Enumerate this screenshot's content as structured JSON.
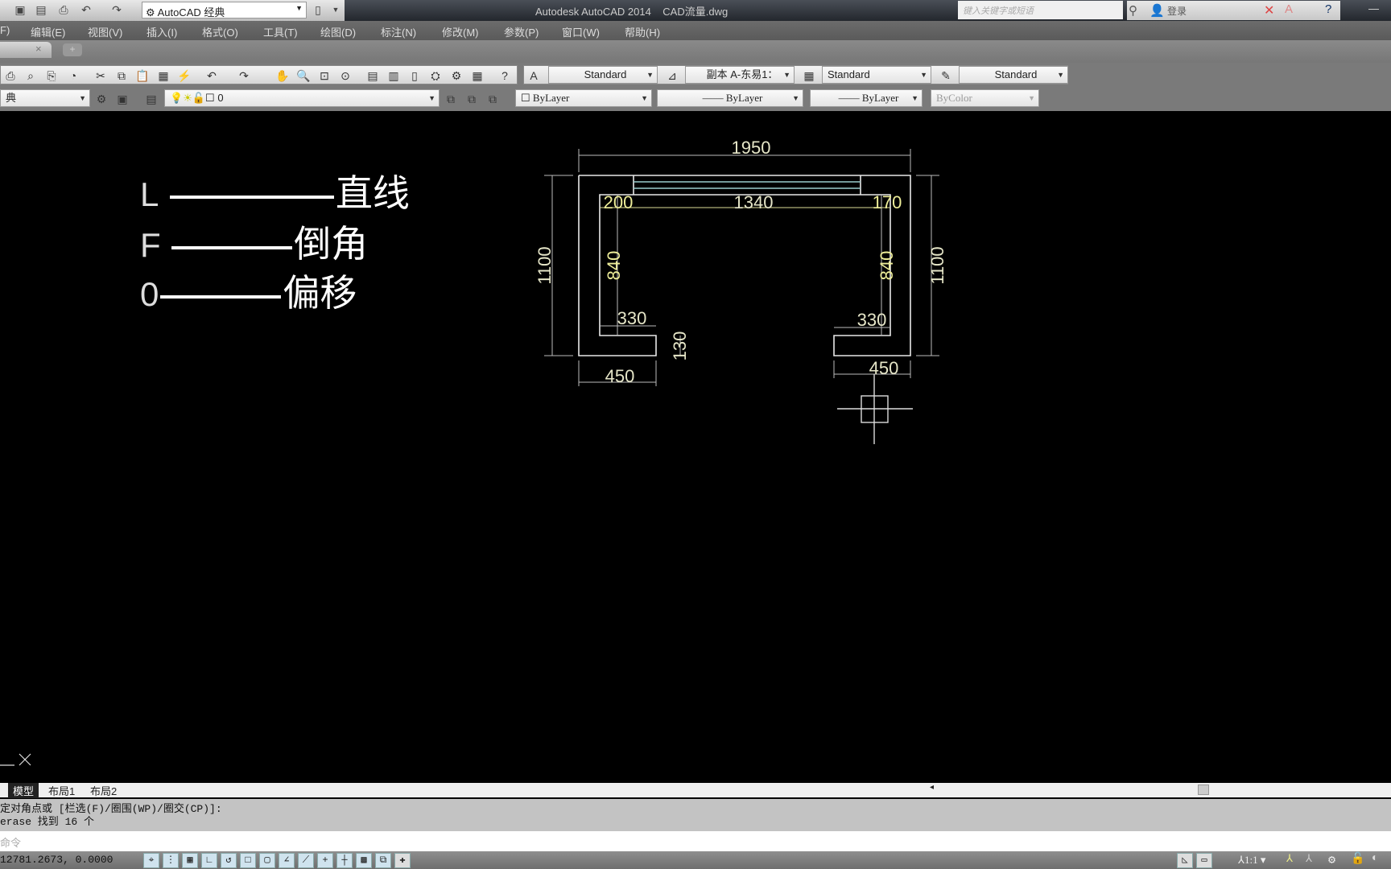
{
  "titlebar": {
    "workspace": "AutoCAD 经典",
    "app_title": "Autodesk AutoCAD 2014",
    "file_name": "CAD流量.dwg",
    "search_placeholder": "键入关键字或短语",
    "login": "登录"
  },
  "menu": [
    "F)",
    "编辑(E)",
    "视图(V)",
    "插入(I)",
    "格式(O)",
    "工具(T)",
    "绘图(D)",
    "标注(N)",
    "修改(M)",
    "参数(P)",
    "窗口(W)",
    "帮助(H)"
  ],
  "toolbar": {
    "text_style": "Standard",
    "dim_style": "副本 A-东易1：",
    "table_style": "Standard",
    "multileader_style": "Standard",
    "workspace_short": "典",
    "layer": "0",
    "color": "ByLayer",
    "linetype": "ByLayer",
    "lineweight": "ByLayer",
    "plotstyle": "ByColor"
  },
  "legend": [
    {
      "key": "L",
      "label": "直线"
    },
    {
      "key": "F",
      "label": "倒角"
    },
    {
      "key": "0",
      "label": "偏移"
    }
  ],
  "drawing": {
    "dims": {
      "overall_width": "1950",
      "height_left": "1100",
      "height_right": "1100",
      "left_offset": "200",
      "middle": "1340",
      "right_offset": "170",
      "inner_left": "840",
      "inner_right": "840",
      "foot_left": "330",
      "foot_right": "330",
      "foot_thickness": "130",
      "base_left": "450",
      "base_right": "450"
    }
  },
  "ucs_label": "X",
  "layout_tabs": [
    "模型",
    "布局1",
    "布局2"
  ],
  "command_history": [
    "定对角点或 [栏选(F)/圈围(WP)/圈交(CP)]:",
    "erase 找到 16 个"
  ],
  "command_placeholder": "命令",
  "status": {
    "coords": "12781.2673, 0.0000",
    "annotation_scale": "1:1"
  }
}
